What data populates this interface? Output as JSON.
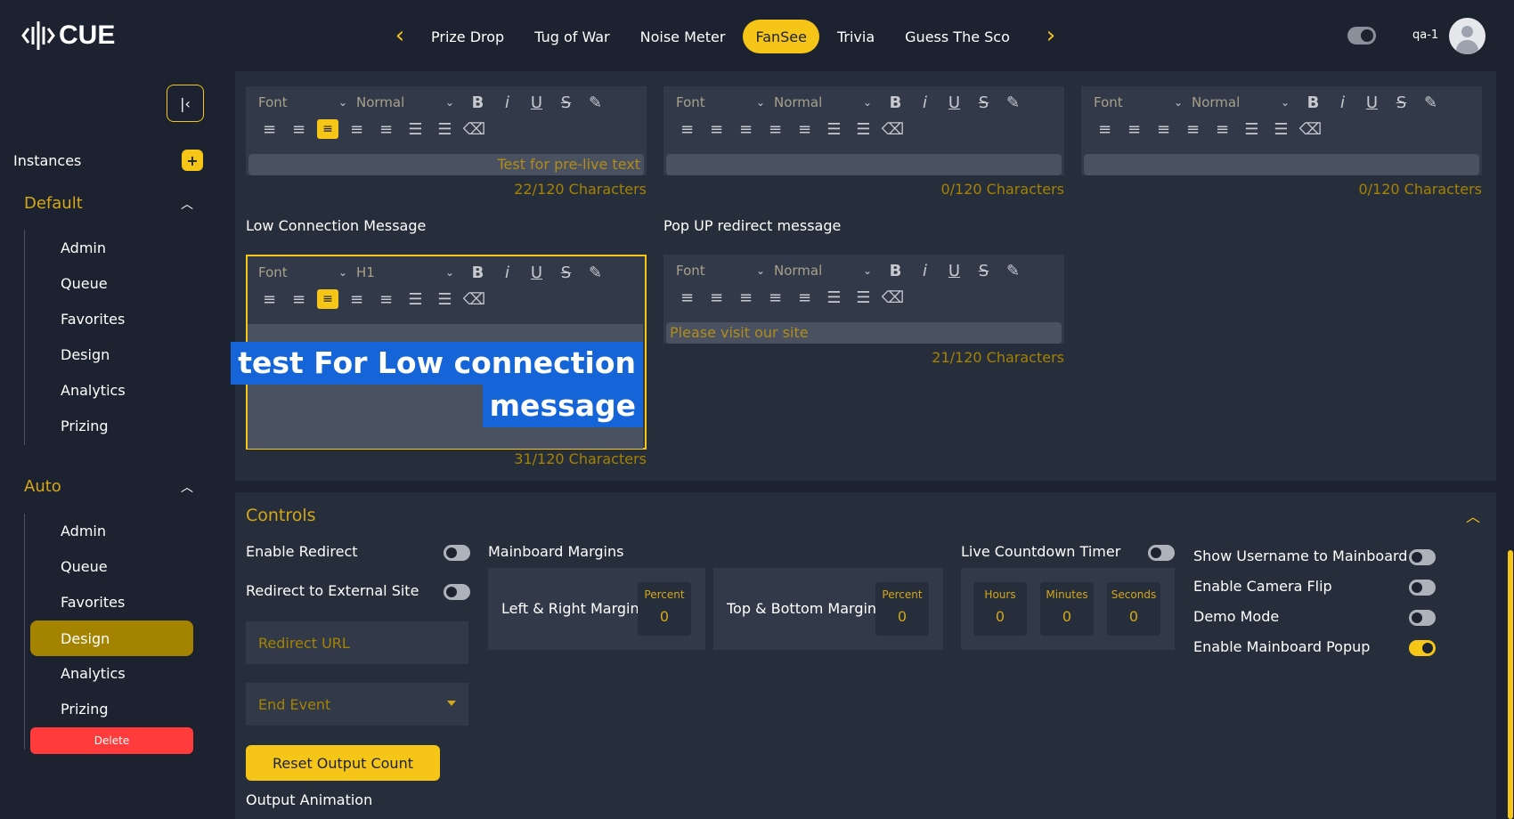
{
  "app": {
    "logo_text": "CUE",
    "user": "qa-1"
  },
  "nav": {
    "tabs": [
      {
        "label": "Prize Drop",
        "active": false
      },
      {
        "label": "Tug of War",
        "active": false
      },
      {
        "label": "Noise Meter",
        "active": false
      },
      {
        "label": "FanSee",
        "active": true
      },
      {
        "label": "Trivia",
        "active": false
      },
      {
        "label": "Guess The Sco",
        "active": false
      }
    ]
  },
  "sidebar": {
    "instances_label": "Instances",
    "add_label": "+",
    "groups": [
      {
        "title": "Default",
        "items": [
          "Admin",
          "Queue",
          "Favorites",
          "Design",
          "Analytics",
          "Prizing"
        ]
      },
      {
        "title": "Auto",
        "items": [
          "Admin",
          "Queue",
          "Favorites",
          "Design",
          "Analytics",
          "Prizing"
        ],
        "active_item": "Design"
      }
    ],
    "delete_label": "Delete"
  },
  "editors": {
    "toolbar": {
      "font": "Font",
      "size_normal": "Normal",
      "size_h1": "H1"
    },
    "top": [
      {
        "content": "Test for pre-live text",
        "count": "22/120 Characters"
      },
      {
        "content": "",
        "count": "0/120 Characters"
      },
      {
        "content": "",
        "count": "0/120 Characters"
      }
    ],
    "low_connection": {
      "label": "Low Connection Message",
      "line1": "test For Low connection",
      "line2": "message",
      "count": "31/120 Characters"
    },
    "popup": {
      "label": "Pop UP redirect message",
      "content": "Please visit our site",
      "count": "21/120 Characters"
    }
  },
  "controls": {
    "title": "Controls",
    "enable_redirect": "Enable Redirect",
    "redirect_external": "Redirect to External Site",
    "redirect_url_placeholder": "Redirect URL",
    "end_event_placeholder": "End Event",
    "reset_button": "Reset Output Count",
    "output_animation": "Output Animation",
    "mainboard_margins": "Mainboard Margins",
    "lr_margin": "Left & Right Margin",
    "tb_margin": "Top & Bottom Margin",
    "percent_label": "Percent",
    "lr_value": "0",
    "tb_value": "0",
    "countdown_label": "Live Countdown Timer",
    "hours_label": "Hours",
    "minutes_label": "Minutes",
    "seconds_label": "Seconds",
    "hours_value": "0",
    "minutes_value": "0",
    "seconds_value": "0",
    "show_username": "Show Username to Mainboard",
    "camera_flip": "Enable Camera Flip",
    "demo_mode": "Demo Mode",
    "mainboard_popup": "Enable Mainboard Popup",
    "toggles": {
      "enable_redirect": false,
      "redirect_external": false,
      "countdown": false,
      "show_username": false,
      "camera_flip": false,
      "demo_mode": false,
      "mainboard_popup": true
    }
  },
  "colors": {
    "accent": "#f5c518",
    "background": "#1c2230",
    "panel": "#262d3b",
    "delete": "#ff3b3b"
  }
}
